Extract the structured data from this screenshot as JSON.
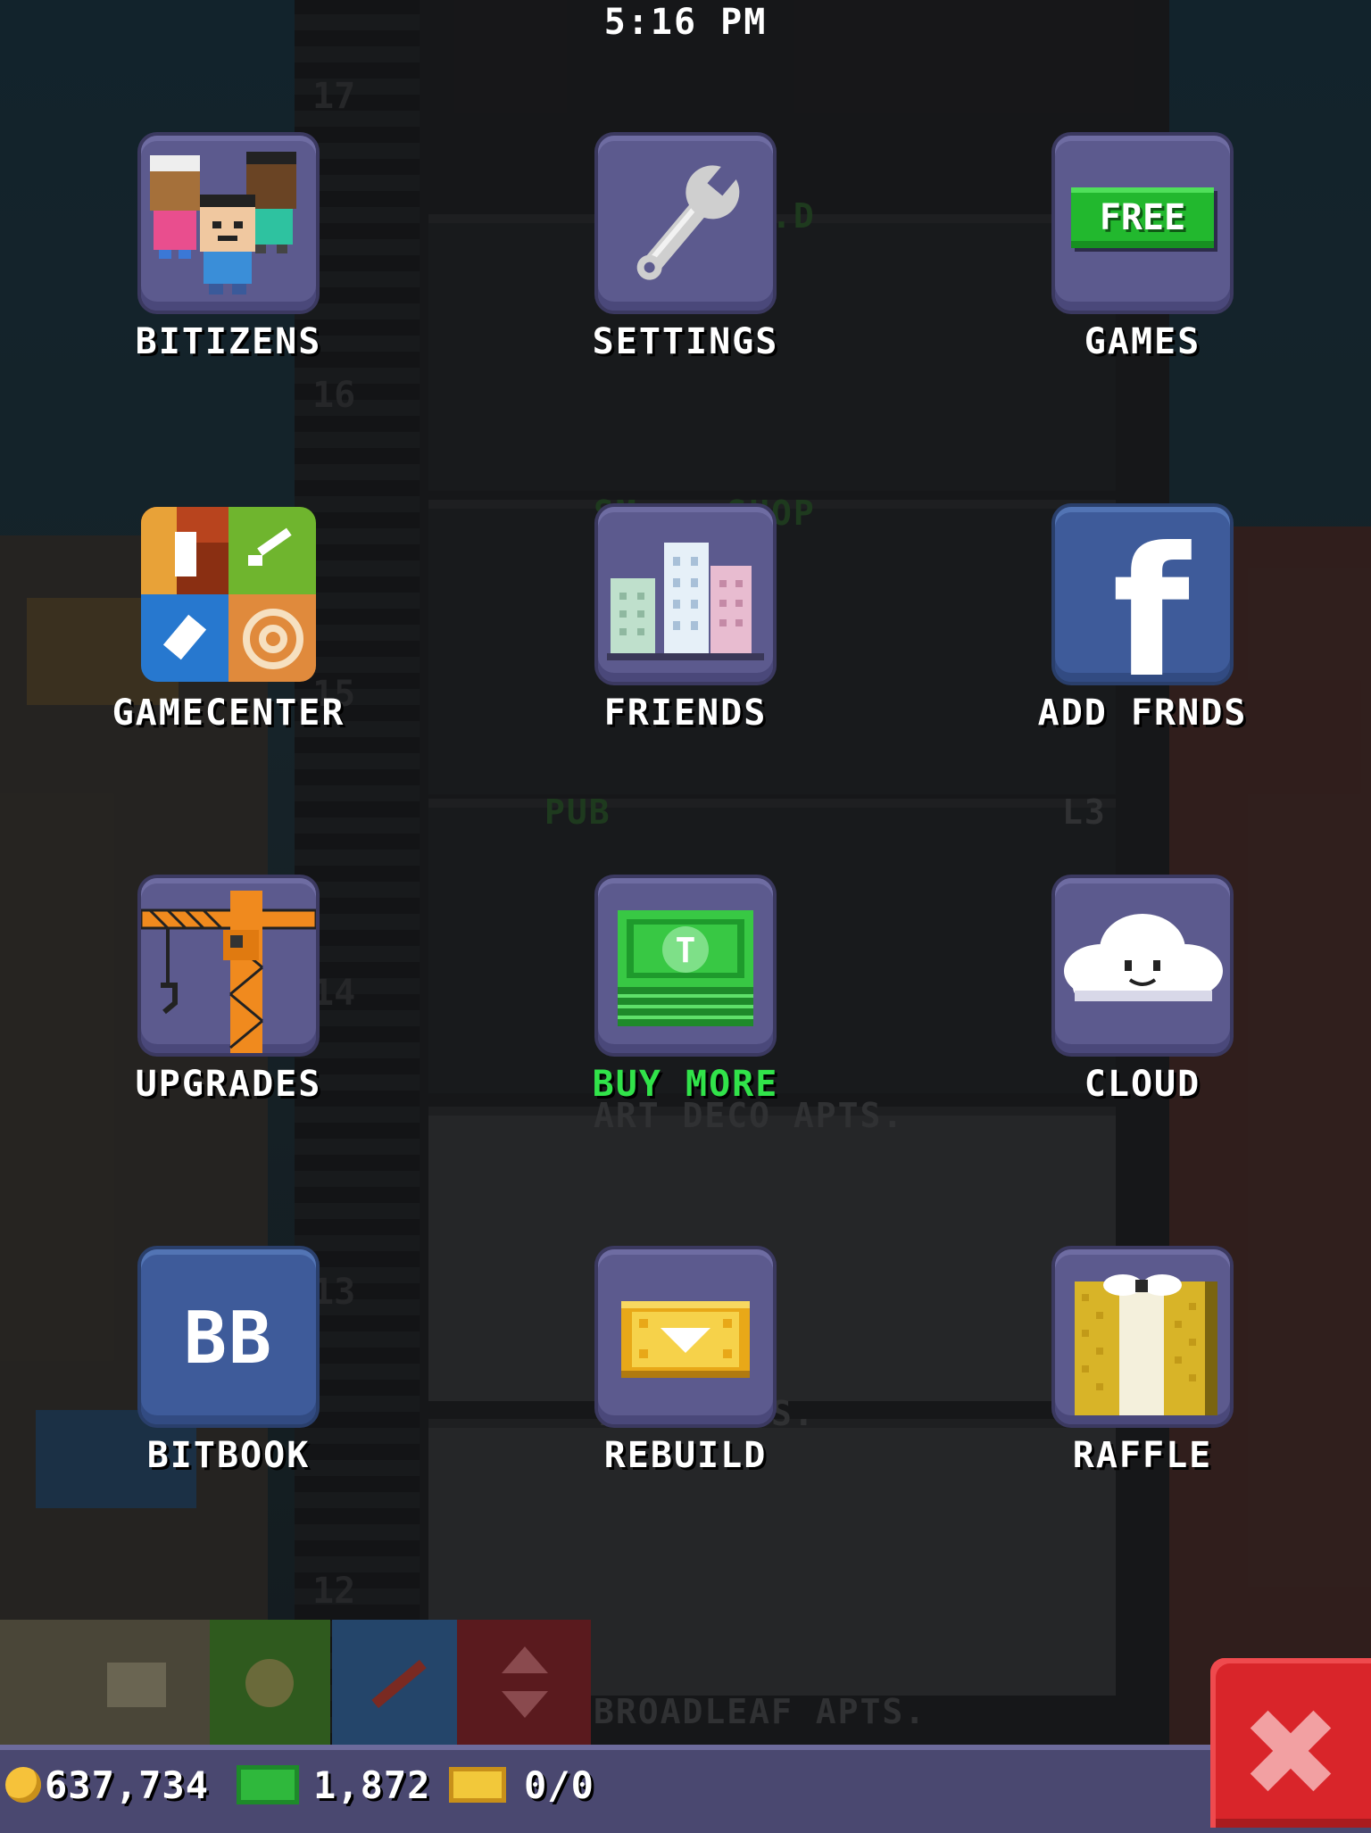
{
  "status_bar": {
    "time": "5:16 PM"
  },
  "menu": {
    "items": [
      {
        "label": "BITIZENS",
        "icon": "bitizens-icon"
      },
      {
        "label": "SETTINGS",
        "icon": "wrench-icon"
      },
      {
        "label": "GAMES",
        "icon": "free-games-icon",
        "badge": "FREE"
      },
      {
        "label": "GAMECENTER",
        "icon": "gamecenter-icon"
      },
      {
        "label": "FRIENDS",
        "icon": "city-buildings-icon"
      },
      {
        "label": "ADD FRNDS",
        "icon": "facebook-icon",
        "icon_text": "f"
      },
      {
        "label": "UPGRADES",
        "icon": "crane-icon"
      },
      {
        "label": "BUY MORE",
        "icon": "tower-bux-icon",
        "icon_text": "T",
        "label_color": "#31e34a"
      },
      {
        "label": "CLOUD",
        "icon": "cloud-icon"
      },
      {
        "label": "BITBOOK",
        "icon": "bitbook-icon",
        "icon_text": "BB"
      },
      {
        "label": "REBUILD",
        "icon": "golden-ticket-icon"
      },
      {
        "label": "RAFFLE",
        "icon": "raffle-ticket-icon"
      }
    ]
  },
  "background": {
    "floors": [
      {
        "number": "17"
      },
      {
        "number": "16",
        "name": "VE... ...D"
      },
      {
        "number": "15",
        "name": "SM... SHOP"
      },
      {
        "number": "14",
        "name": "PUB",
        "level": "L3"
      },
      {
        "number": "13",
        "name": "ART DECO APTS."
      },
      {
        "number": "12",
        "name": "...N APTS."
      },
      {
        "name": "BROADLEAF APTS."
      }
    ]
  },
  "hud": {
    "coins": "637,734",
    "bux": "1,872",
    "tickets": "0/0"
  },
  "colors": {
    "tile": "#5c5a8e",
    "tile_blue": "#3e5b9a",
    "accent_green": "#31e34a",
    "close_red": "#d9252a",
    "hud_bar": "#4a4870"
  }
}
